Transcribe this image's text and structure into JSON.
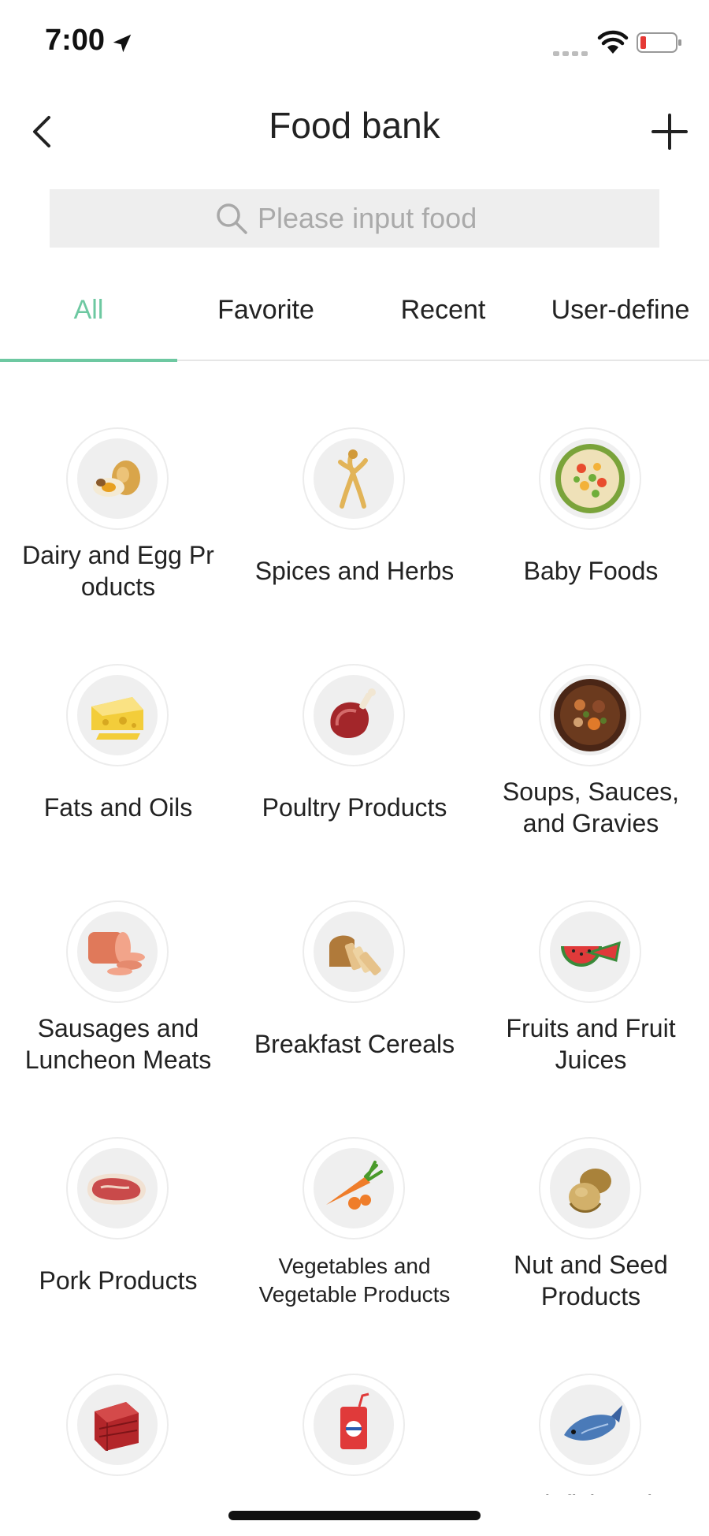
{
  "status_bar": {
    "time": "7:00",
    "icons": [
      "location-arrow-icon",
      "signal-icon",
      "wifi-icon",
      "battery-icon"
    ],
    "battery_color": "#e53935"
  },
  "nav": {
    "title": "Food bank",
    "back_icon": "chevron-left-icon",
    "add_icon": "plus-icon"
  },
  "search": {
    "placeholder": "Please input food",
    "value": ""
  },
  "tabs": [
    {
      "label": "All",
      "active": true
    },
    {
      "label": "Favorite",
      "active": false
    },
    {
      "label": "Recent",
      "active": false
    },
    {
      "label": "User-define",
      "active": false
    }
  ],
  "colors": {
    "accent": "#6dc8a1",
    "search_bg": "#eeeeee",
    "icon_bg": "#efefef"
  },
  "categories": [
    {
      "label": "Dairy and Egg Pr oducts",
      "icon": "egg-icon"
    },
    {
      "label": "Spices and Herbs",
      "icon": "ginseng-icon"
    },
    {
      "label": "Baby Foods",
      "icon": "baby-food-icon"
    },
    {
      "label": "Fats and Oils",
      "icon": "cheese-icon"
    },
    {
      "label": "Poultry Products",
      "icon": "ham-icon"
    },
    {
      "label": "Soups, Sauces, and Gravies",
      "icon": "stew-icon"
    },
    {
      "label": "Sausages and Luncheon Meats",
      "icon": "sausage-icon"
    },
    {
      "label": "Breakfast Cereals",
      "icon": "bread-icon"
    },
    {
      "label": "Fruits and Fruit Juices",
      "icon": "watermelon-icon"
    },
    {
      "label": "Pork Products",
      "icon": "steak-icon"
    },
    {
      "label": "Vegetables and Vegetable Products",
      "icon": "carrot-icon"
    },
    {
      "label": "Nut and Seed Products",
      "icon": "nuts-icon"
    },
    {
      "label": "",
      "icon": "beef-icon"
    },
    {
      "label": "",
      "icon": "drink-can-icon"
    },
    {
      "label": "Finfish and",
      "icon": "fish-icon"
    }
  ]
}
